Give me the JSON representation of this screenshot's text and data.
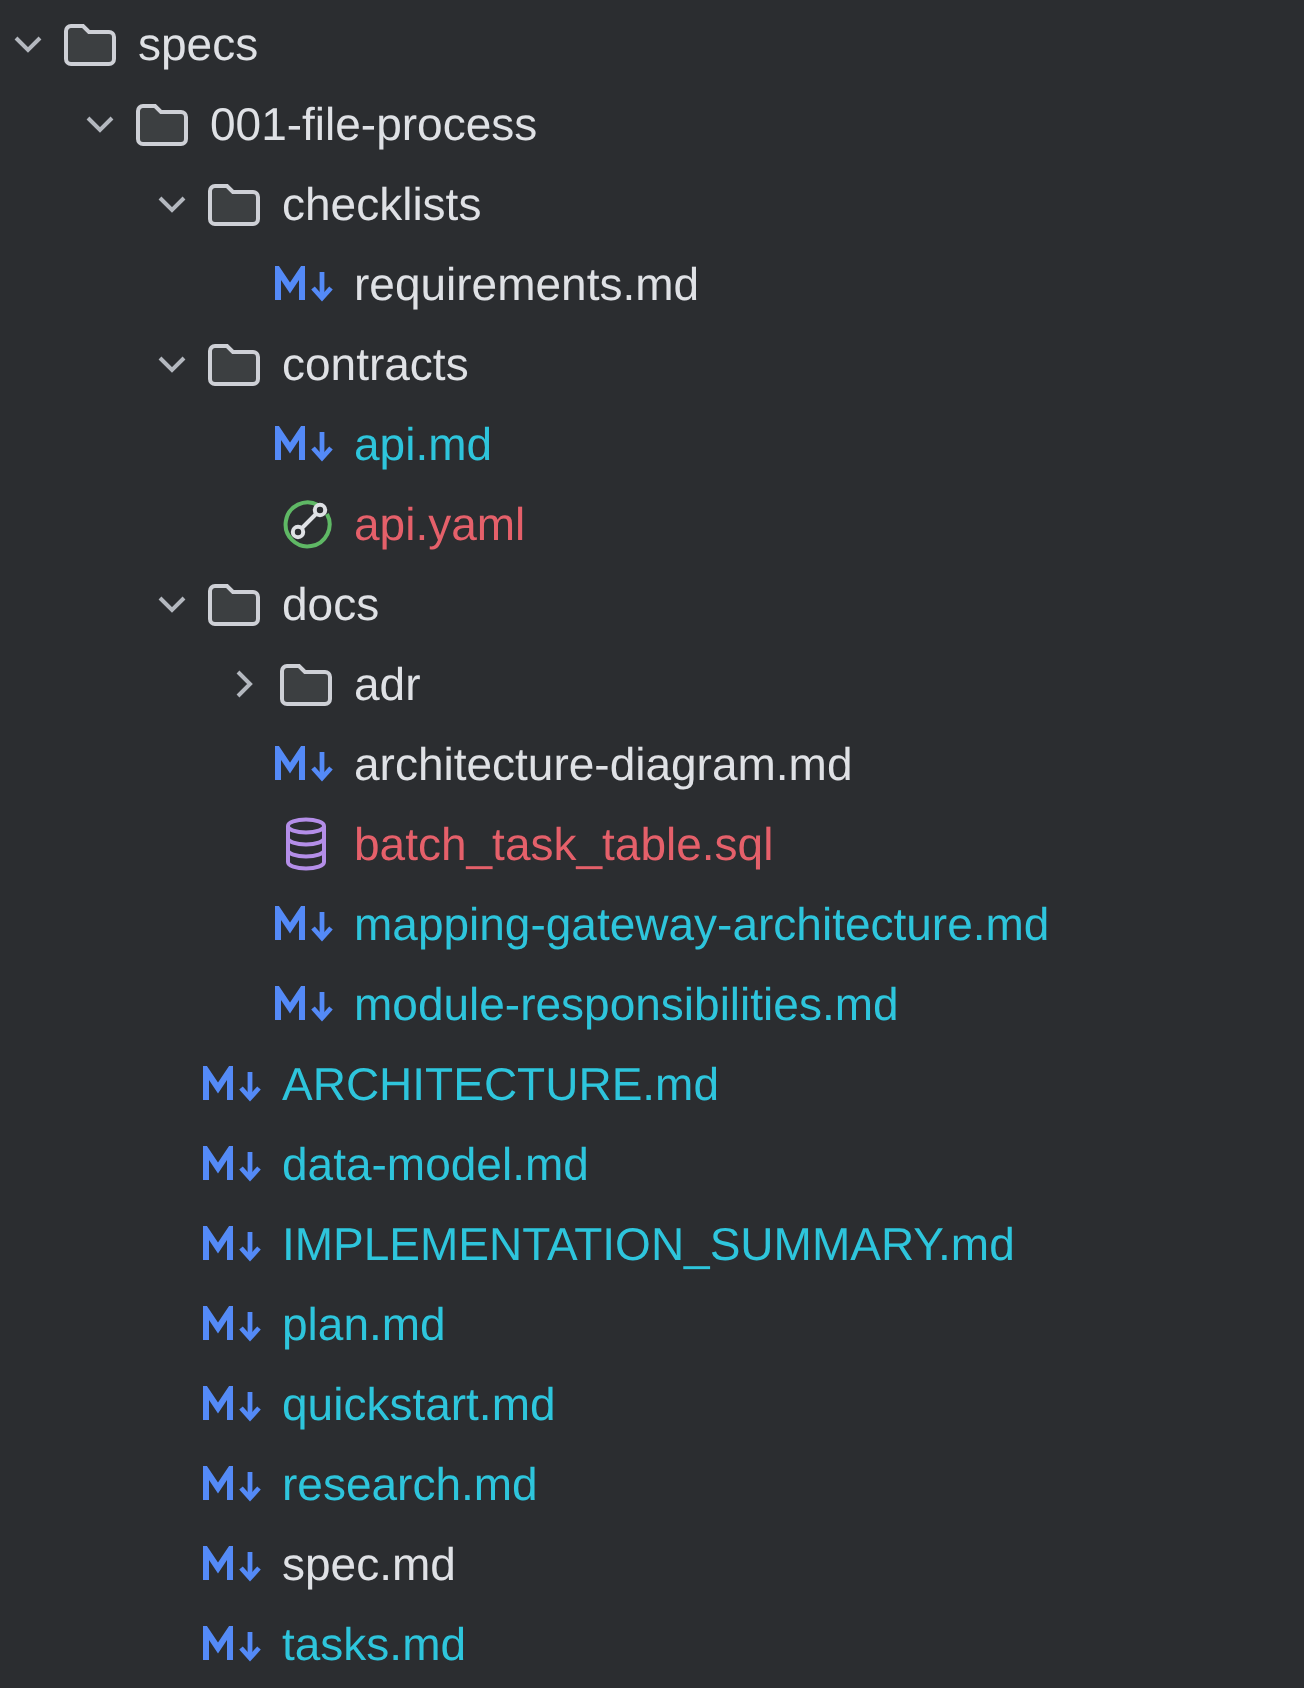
{
  "tree": [
    {
      "name": "specs",
      "kind": "folder",
      "expanded": true,
      "color": "#dfe1e5",
      "children": [
        {
          "name": "001-file-process",
          "kind": "folder",
          "expanded": true,
          "color": "#dfe1e5",
          "children": [
            {
              "name": "checklists",
              "kind": "folder",
              "expanded": true,
              "color": "#dfe1e5",
              "children": [
                {
                  "name": "requirements.md",
                  "kind": "markdown",
                  "color": "#dfe1e5"
                }
              ]
            },
            {
              "name": "contracts",
              "kind": "folder",
              "expanded": true,
              "color": "#dfe1e5",
              "children": [
                {
                  "name": "api.md",
                  "kind": "markdown",
                  "color": "#2ec5dc"
                },
                {
                  "name": "api.yaml",
                  "kind": "openapi",
                  "color": "#e5606a"
                }
              ]
            },
            {
              "name": "docs",
              "kind": "folder",
              "expanded": true,
              "color": "#dfe1e5",
              "children": [
                {
                  "name": "adr",
                  "kind": "folder",
                  "expanded": false,
                  "color": "#dfe1e5"
                },
                {
                  "name": "architecture-diagram.md",
                  "kind": "markdown",
                  "color": "#dfe1e5"
                },
                {
                  "name": "batch_task_table.sql",
                  "kind": "sql",
                  "color": "#e5606a"
                },
                {
                  "name": "mapping-gateway-architecture.md",
                  "kind": "markdown",
                  "color": "#2ec5dc"
                },
                {
                  "name": "module-responsibilities.md",
                  "kind": "markdown",
                  "color": "#2ec5dc"
                }
              ]
            },
            {
              "name": "ARCHITECTURE.md",
              "kind": "markdown",
              "color": "#2ec5dc"
            },
            {
              "name": "data-model.md",
              "kind": "markdown",
              "color": "#2ec5dc"
            },
            {
              "name": "IMPLEMENTATION_SUMMARY.md",
              "kind": "markdown",
              "color": "#2ec5dc"
            },
            {
              "name": "plan.md",
              "kind": "markdown",
              "color": "#2ec5dc"
            },
            {
              "name": "quickstart.md",
              "kind": "markdown",
              "color": "#2ec5dc"
            },
            {
              "name": "research.md",
              "kind": "markdown",
              "color": "#2ec5dc"
            },
            {
              "name": "spec.md",
              "kind": "markdown",
              "color": "#dfe1e5"
            },
            {
              "name": "tasks.md",
              "kind": "markdown",
              "color": "#2ec5dc"
            }
          ]
        }
      ]
    }
  ]
}
